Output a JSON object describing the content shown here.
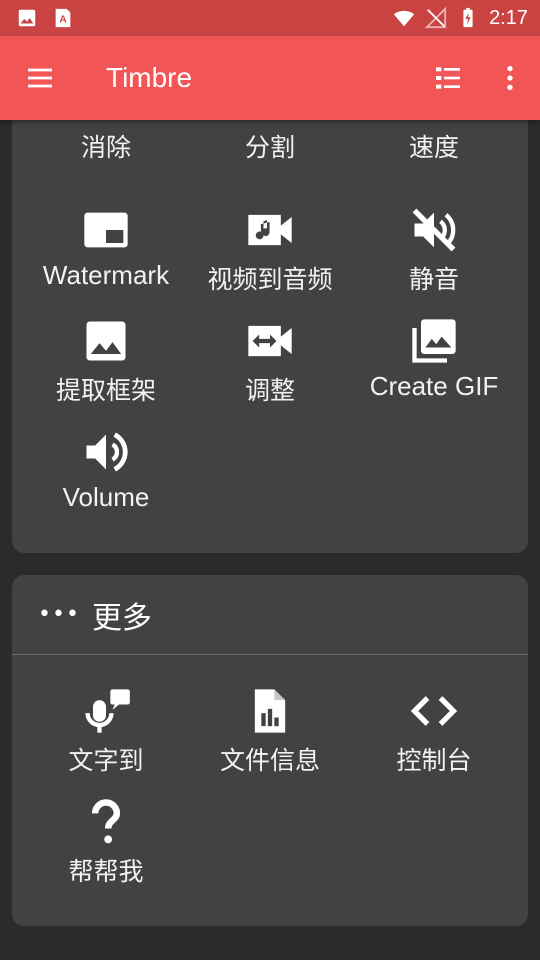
{
  "status_bar": {
    "time": "2:17"
  },
  "app_bar": {
    "title": "Timbre"
  },
  "tools": {
    "partial_row": [
      "消除",
      "分割",
      "速度"
    ],
    "items": [
      {
        "label": "Watermark",
        "icon": "watermark-icon"
      },
      {
        "label": "视频到音频",
        "icon": "video-to-audio-icon"
      },
      {
        "label": "静音",
        "icon": "mute-icon"
      },
      {
        "label": "提取框架",
        "icon": "image-icon"
      },
      {
        "label": "调整",
        "icon": "resize-video-icon"
      },
      {
        "label": "Create GIF",
        "icon": "photo-library-icon"
      },
      {
        "label": "Volume",
        "icon": "volume-icon"
      }
    ]
  },
  "more": {
    "title": "更多",
    "items": [
      {
        "label": "文字到",
        "icon": "voice-to-text-icon"
      },
      {
        "label": "文件信息",
        "icon": "file-chart-icon"
      },
      {
        "label": "控制台",
        "icon": "code-icon"
      },
      {
        "label": "帮帮我",
        "icon": "question-icon"
      }
    ]
  },
  "colors": {
    "app_bar": "#f25555",
    "status_bar": "#c94343",
    "background": "#2b2b2b",
    "card": "#424242"
  }
}
